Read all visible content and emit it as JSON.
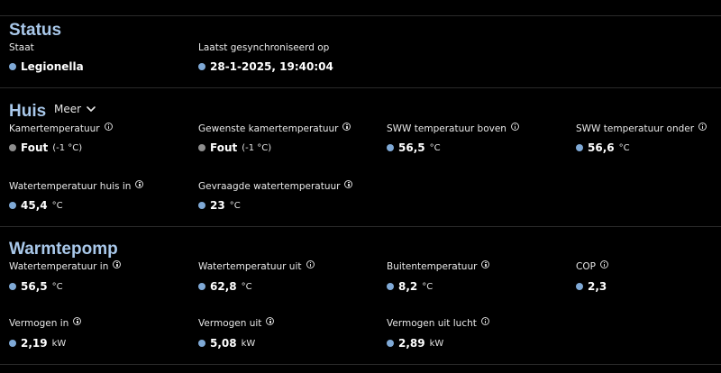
{
  "status": {
    "title": "Status",
    "state_label": "Staat",
    "state_value": "Legionella",
    "sync_label": "Laatst gesynchroniseerd op",
    "sync_value": "28-1-2025, 19:40:04"
  },
  "huis": {
    "title": "Huis",
    "more_label": "Meer",
    "items": [
      {
        "label": "Kamertemperatuur",
        "value": "Fout",
        "unit": "(-1 °C)",
        "status": "gray"
      },
      {
        "label": "Gewenste kamertemperatuur",
        "value": "Fout",
        "unit": "(-1 °C)",
        "status": "gray"
      },
      {
        "label": "SWW temperatuur boven",
        "value": "56,5",
        "unit": "°C",
        "status": "blue"
      },
      {
        "label": "SWW temperatuur onder",
        "value": "56,6",
        "unit": "°C",
        "status": "blue"
      },
      {
        "label": "Watertemperatuur huis in",
        "value": "45,4",
        "unit": "°C",
        "status": "blue"
      },
      {
        "label": "Gevraagde watertemperatuur",
        "value": "23",
        "unit": "°C",
        "status": "blue"
      }
    ]
  },
  "warmtepomp": {
    "title": "Warmtepomp",
    "items": [
      {
        "label": "Watertemperatuur in",
        "value": "56,5",
        "unit": "°C"
      },
      {
        "label": "Watertemperatuur uit",
        "value": "62,8",
        "unit": "°C"
      },
      {
        "label": "Buitentemperatuur",
        "value": "8,2",
        "unit": "°C"
      },
      {
        "label": "COP",
        "value": "2,3",
        "unit": ""
      },
      {
        "label": "Vermogen in",
        "value": "2,19",
        "unit": "kW"
      },
      {
        "label": "Vermogen uit",
        "value": "5,08",
        "unit": "kW"
      },
      {
        "label": "Vermogen uit lucht",
        "value": "2,89",
        "unit": "kW"
      }
    ]
  },
  "colors": {
    "background": "#000000",
    "section_title": "#a9c8ea",
    "status_dot": "#7fa9d6",
    "error_dot": "#8e8e8e"
  }
}
